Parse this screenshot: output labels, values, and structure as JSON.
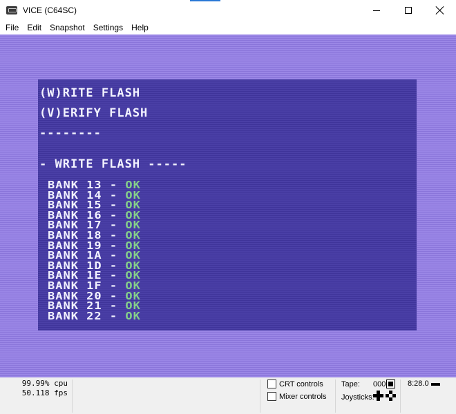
{
  "window": {
    "title": "VICE (C64SC)"
  },
  "menu": [
    "File",
    "Edit",
    "Snapshot",
    "Settings",
    "Help"
  ],
  "screen": {
    "menu_lines": [
      "(W)RITE FLASH",
      "(V)ERIFY FLASH",
      "--------"
    ],
    "section_header": "- WRITE FLASH -----",
    "banks": [
      {
        "label": "BANK 13 - ",
        "status": "OK"
      },
      {
        "label": "BANK 14 - ",
        "status": "OK"
      },
      {
        "label": "BANK 15 - ",
        "status": "OK"
      },
      {
        "label": "BANK 16 - ",
        "status": "OK"
      },
      {
        "label": "BANK 17 - ",
        "status": "OK"
      },
      {
        "label": "BANK 18 - ",
        "status": "OK"
      },
      {
        "label": "BANK 19 - ",
        "status": "OK"
      },
      {
        "label": "BANK 1A - ",
        "status": "OK"
      },
      {
        "label": "BANK 1D - ",
        "status": "OK"
      },
      {
        "label": "BANK 1E - ",
        "status": "OK"
      },
      {
        "label": "BANK 1F - ",
        "status": "OK"
      },
      {
        "label": "BANK 20 - ",
        "status": "OK"
      },
      {
        "label": "BANK 21 - ",
        "status": "OK"
      },
      {
        "label": "BANK 22 - ",
        "status": "OK"
      }
    ],
    "colors": {
      "border": "#9a86e6",
      "background": "#4a3fa6",
      "text": "#f2f2ff",
      "ok": "#86d08a"
    }
  },
  "status": {
    "cpu": "99.99% cpu",
    "fps": "50.118 fps",
    "crt_controls": "CRT controls",
    "mixer_controls": "Mixer controls",
    "tape_label": "Tape:",
    "tape_counter": "000",
    "clock": "8:28.0",
    "joysticks_label": "Joysticks:"
  },
  "icons": {
    "app": "vice-app-icon",
    "tape": "tape-stop-icon",
    "drive": "drive-led-icon",
    "joystick": "joystick-icon"
  }
}
